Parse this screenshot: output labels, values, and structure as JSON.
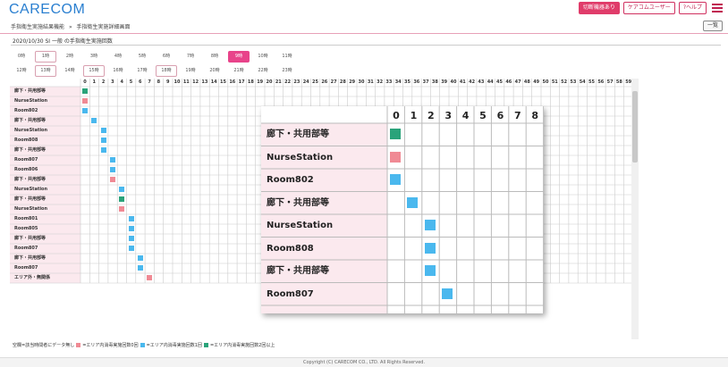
{
  "header": {
    "logo": "CARECOM",
    "buttons": [
      "切断機器あり",
      "ケアコムユーザー",
      "?ヘルプ"
    ],
    "alert_color": "#e03c6a"
  },
  "breadcrumb": {
    "items": [
      "手指衛生実施結果機能",
      "手指衛生実施詳細画面"
    ],
    "separator": "»"
  },
  "list_button": "一覧",
  "title": "2020/10/30 SI 一般 の手指衛生実施回数",
  "hours": {
    "row1": [
      "0時",
      "1時",
      "2時",
      "3時",
      "4時",
      "5時",
      "6時",
      "7時",
      "8時",
      "9時",
      "10時",
      "11時"
    ],
    "row2": [
      "12時",
      "13時",
      "14時",
      "15時",
      "16時",
      "17時",
      "18時",
      "19時",
      "20時",
      "21時",
      "22時",
      "23時"
    ],
    "active": "9時",
    "bordered": [
      "1時",
      "13時",
      "15時",
      "18時"
    ]
  },
  "grid": {
    "columns": [
      "0",
      "1",
      "2",
      "3",
      "4",
      "5",
      "6",
      "7",
      "8",
      "9",
      "10",
      "11",
      "12",
      "13",
      "14",
      "15",
      "16",
      "17",
      "18",
      "19",
      "20",
      "21",
      "22",
      "23",
      "24",
      "25",
      "26",
      "27",
      "28",
      "29",
      "30",
      "31",
      "32",
      "33",
      "34",
      "35",
      "36",
      "37",
      "38",
      "39",
      "40",
      "41",
      "42",
      "43",
      "44",
      "45",
      "46",
      "47",
      "48",
      "49",
      "50",
      "51",
      "52",
      "53",
      "54",
      "55",
      "56",
      "57",
      "58",
      "59"
    ],
    "rows": [
      {
        "label": "廊下・共用部等",
        "col": 0,
        "level": "green"
      },
      {
        "label": "NurseStation",
        "col": 0,
        "level": "pink"
      },
      {
        "label": "Room802",
        "col": 0,
        "level": "blue"
      },
      {
        "label": "廊下・共用部等",
        "col": 1,
        "level": "blue"
      },
      {
        "label": "NurseStation",
        "col": 2,
        "level": "blue"
      },
      {
        "label": "Room808",
        "col": 2,
        "level": "blue"
      },
      {
        "label": "廊下・共用部等",
        "col": 2,
        "level": "blue"
      },
      {
        "label": "Room807",
        "col": 3,
        "level": "blue"
      },
      {
        "label": "Room806",
        "col": 3,
        "level": "blue"
      },
      {
        "label": "廊下・共用部等",
        "col": 3,
        "level": "pink"
      },
      {
        "label": "NurseStation",
        "col": 4,
        "level": "blue"
      },
      {
        "label": "廊下・共用部等",
        "col": 4,
        "level": "green"
      },
      {
        "label": "NurseStation",
        "col": 4,
        "level": "pink"
      },
      {
        "label": "Room801",
        "col": 5,
        "level": "blue"
      },
      {
        "label": "Room805",
        "col": 5,
        "level": "blue"
      },
      {
        "label": "廊下・共用部等",
        "col": 5,
        "level": "blue"
      },
      {
        "label": "Room807",
        "col": 5,
        "level": "blue"
      },
      {
        "label": "廊下・共用部等",
        "col": 6,
        "level": "blue"
      },
      {
        "label": "Room807",
        "col": 6,
        "level": "blue"
      },
      {
        "label": "エリア外・無関係",
        "col": 7,
        "level": "pink"
      }
    ]
  },
  "zoom": {
    "columns": [
      "0",
      "1",
      "2",
      "3",
      "4",
      "5",
      "6",
      "7",
      "8"
    ],
    "rows": [
      {
        "label": "廊下・共用部等",
        "col": 0,
        "level": "green"
      },
      {
        "label": "NurseStation",
        "col": 0,
        "level": "pink"
      },
      {
        "label": "Room802",
        "col": 0,
        "level": "blue"
      },
      {
        "label": "廊下・共用部等",
        "col": 1,
        "level": "blue"
      },
      {
        "label": "NurseStation",
        "col": 2,
        "level": "blue"
      },
      {
        "label": "Room808",
        "col": 2,
        "level": "blue"
      },
      {
        "label": "廊下・共用部等",
        "col": 2,
        "level": "blue"
      },
      {
        "label": "Room807",
        "col": 3,
        "level": "blue"
      }
    ]
  },
  "legend": {
    "blank": "空欄=該当時間者にデータ無し",
    "pink": "=エリア内消毒実施回数0回",
    "blue": "=エリア内消毒実施回数1回",
    "green": "=エリア内消毒実施回数2回以上"
  },
  "colors": {
    "pink": "#f08a94",
    "blue": "#4ab8ee",
    "green": "#2aa37a",
    "label_bg": "#fbe9ee"
  },
  "footer": "Copyright (C) CARECOM CO., LTD. All Rights Reserved."
}
